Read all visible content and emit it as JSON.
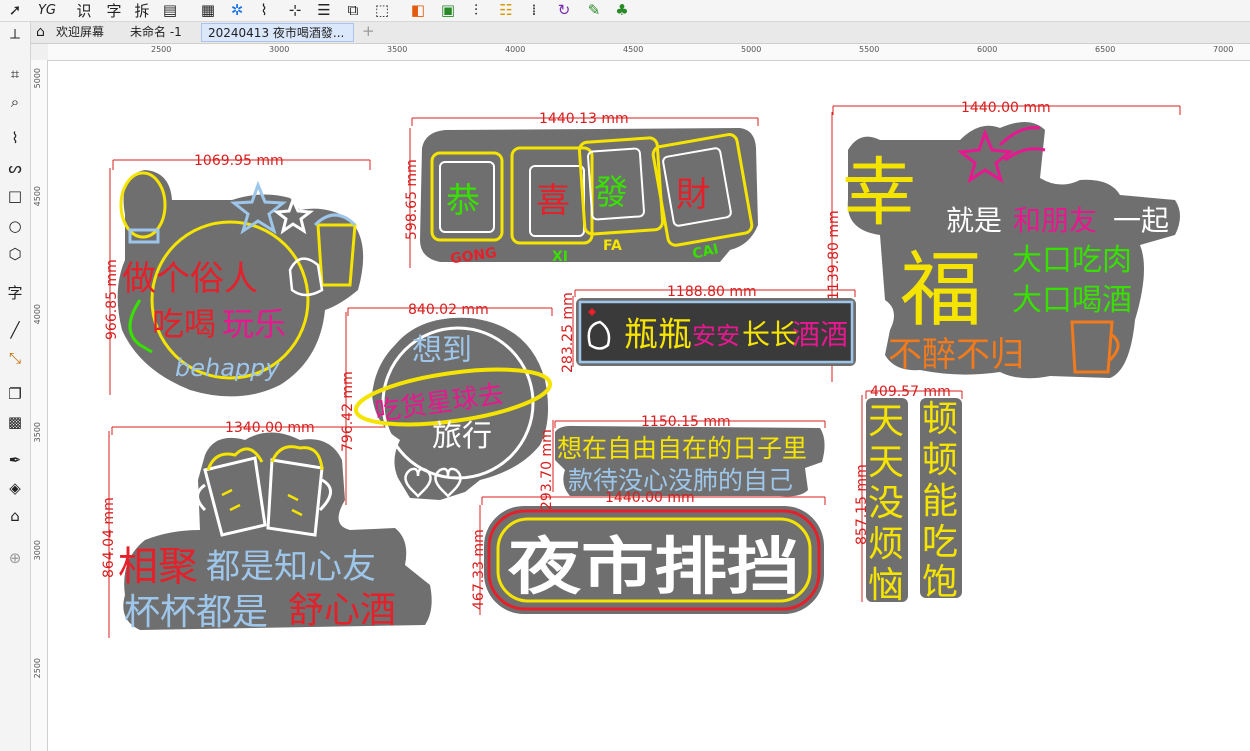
{
  "app": {
    "top_tools": [
      "识",
      "字",
      "拆"
    ],
    "tabs": [
      {
        "label": "欢迎屏幕",
        "active": false
      },
      {
        "label": "未命名 -1",
        "active": false
      },
      {
        "label": "20240413 夜市喝酒發...",
        "active": true
      }
    ],
    "new_tab_symbol": "+",
    "side_text_tool": "字"
  },
  "rulers": {
    "horizontal": [
      "2500",
      "3000",
      "3500",
      "4000",
      "4500",
      "5000",
      "5500",
      "6000",
      "6500",
      "7000"
    ],
    "vertical": [
      "5000",
      "4500",
      "4000",
      "3500",
      "3000",
      "2500"
    ]
  },
  "colors": {
    "panel": "#6f6f6f",
    "dim": "#d71f1f",
    "yellow": "#f5e400",
    "red": "#e4202a",
    "green": "#38e000",
    "pink": "#e7188f",
    "blue": "#9ec6ea",
    "orange": "#f07a1c",
    "white": "#ffffff"
  },
  "signs": {
    "s1": {
      "width": "1069.95 mm",
      "height": "966.85 mm",
      "line1": "做个俗人",
      "line2": "吃喝",
      "line2b": "玩乐",
      "line3": "behappy"
    },
    "s2": {
      "width": "1440.13 mm",
      "height": "598.65 mm",
      "chars": [
        "恭",
        "喜",
        "發",
        "財"
      ],
      "pinyin": [
        "GONG",
        "XI",
        "FA",
        "CAI"
      ]
    },
    "s3": {
      "width": "1440.00 mm",
      "height": "1139.80 mm",
      "big1": "幸",
      "big2": "福",
      "line_a": "就是",
      "line_b": "和朋友",
      "line_c": "一起",
      "line_d": "大口吃肉",
      "line_e": "大口喝酒",
      "line_f": "不醉不归"
    },
    "s4": {
      "width": "1188.80 mm",
      "height": "283.25 mm",
      "t1": "瓶瓶",
      "t2": "安安",
      "t3": "长长",
      "t4": "酒酒"
    },
    "s5": {
      "width": "840.02 mm",
      "height": "796.42 mm",
      "t1": "想到",
      "t2": "吃货星球去",
      "t3": "旅行"
    },
    "s6": {
      "width": "1150.15 mm",
      "height": "293.70 mm",
      "t1": "想在自由自在的日子里",
      "t2": "款待没心没肺的自己"
    },
    "s7": {
      "width": "1440.00 mm",
      "height": "467.33 mm",
      "t": "夜市排挡"
    },
    "s8": {
      "width": "409.57 mm",
      "height": "857.15 mm",
      "col1": [
        "天",
        "天",
        "没",
        "烦",
        "恼"
      ],
      "col2": [
        "顿",
        "顿",
        "能",
        "吃",
        "饱"
      ]
    },
    "s9": {
      "width": "1340.00 mm",
      "height": "864.04 mm",
      "l1a": "相聚",
      "l1b": "都是知心友",
      "l2a": "杯杯都是",
      "l2b": "舒心酒"
    }
  }
}
